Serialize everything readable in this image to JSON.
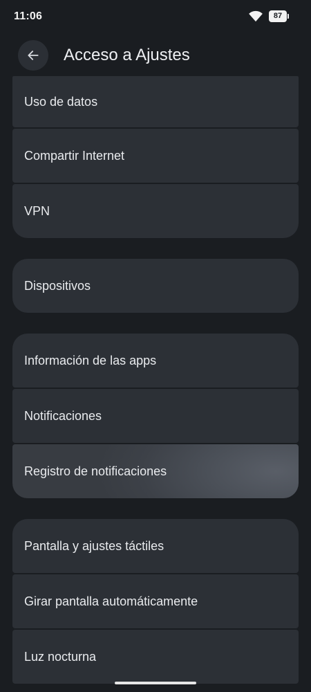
{
  "status_bar": {
    "time": "11:06",
    "battery": "87",
    "wifi_icon": "wifi-icon"
  },
  "header": {
    "back_icon": "arrow-back-icon",
    "title": "Acceso a Ajustes"
  },
  "groups": [
    {
      "items": [
        "Uso de datos",
        "Compartir Internet",
        "VPN"
      ]
    },
    {
      "items": [
        "Dispositivos"
      ]
    },
    {
      "items": [
        "Información de las apps",
        "Notificaciones",
        "Registro de notificaciones"
      ]
    },
    {
      "items": [
        "Pantalla y ajustes táctiles",
        "Girar pantalla automáticamente",
        "Luz nocturna"
      ]
    }
  ],
  "colors": {
    "background": "#1a1d21",
    "card": "#2c3036",
    "highlight": "#4a4f57",
    "text": "#e9ebee"
  }
}
